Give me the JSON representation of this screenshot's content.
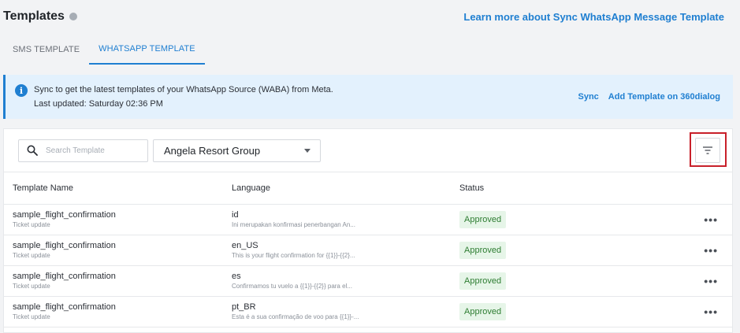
{
  "header": {
    "title": "Templates",
    "learn_more": "Learn more about Sync WhatsApp Message Template"
  },
  "tabs": [
    {
      "label": "SMS TEMPLATE",
      "active": false
    },
    {
      "label": "WHATSAPP TEMPLATE",
      "active": true
    }
  ],
  "banner": {
    "line1": "Sync to get the latest templates of your WhatsApp Source (WABA) from Meta.",
    "line2": "Last updated: Saturday 02:36 PM",
    "sync": "Sync",
    "add_template": "Add Template on 360dialog"
  },
  "toolbar": {
    "search_placeholder": "Search Template",
    "search_value": "",
    "source_selected": "Angela Resort Group"
  },
  "table": {
    "headers": [
      "Template Name",
      "Language",
      "Status"
    ],
    "rows": [
      {
        "name": "sample_flight_confirmation",
        "category": "Ticket update",
        "language": "id",
        "preview": "Ini merupakan konfirmasi penerbangan An...",
        "status": "Approved"
      },
      {
        "name": "sample_flight_confirmation",
        "category": "Ticket update",
        "language": "en_US",
        "preview": "This is your flight confirmation for {{1}}-{{2}...",
        "status": "Approved"
      },
      {
        "name": "sample_flight_confirmation",
        "category": "Ticket update",
        "language": "es",
        "preview": "Confirmamos tu vuelo a {{1}}-{{2}} para el...",
        "status": "Approved"
      },
      {
        "name": "sample_flight_confirmation",
        "category": "Ticket update",
        "language": "pt_BR",
        "preview": "Esta é a sua confirmação de voo para {{1}}-...",
        "status": "Approved"
      }
    ]
  },
  "colors": {
    "accent": "#1f7fd1",
    "approved_bg": "#e6f5e8",
    "approved_text": "#2e7d32",
    "highlight": "#c8202a"
  }
}
